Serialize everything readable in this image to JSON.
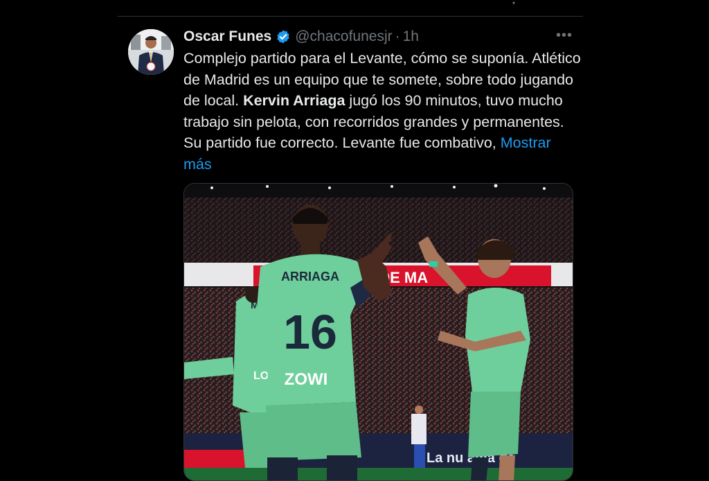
{
  "tweet": {
    "author_name": "Oscar Funes",
    "handle": "@chacofunesjr",
    "separator": "·",
    "time": "1h",
    "text_part1": "Complejo partido para el Levante, cómo se suponía. Atlético de Madrid es un equipo que te somete, sobre todo jugando de local. ",
    "text_bold": "Kervin Arriaga",
    "text_part2": " jugó los 90 minutos,  tuvo mucho trabajo sin pelota, con recorridos grandes y permanentes. Su partido fue correcto. Levante fue combativo, ",
    "show_more": "Mostrar más",
    "more_icon": "more-horizontal-icon",
    "verified_icon": "verified-badge-icon"
  },
  "media": {
    "description_icon": "photo",
    "jersey_name": "ARRIAGA",
    "jersey_number": "16",
    "sponsor": "ZOWI",
    "banner_text": "O DE MA",
    "board_text": "La nu      ama de",
    "teammate_letter": "M.",
    "teammate_text": "LOV"
  },
  "colors": {
    "background": "#000000",
    "text": "#e7e9ea",
    "muted": "#71767b",
    "link": "#1d9bf0",
    "kit_green": "#6fcf9c"
  }
}
